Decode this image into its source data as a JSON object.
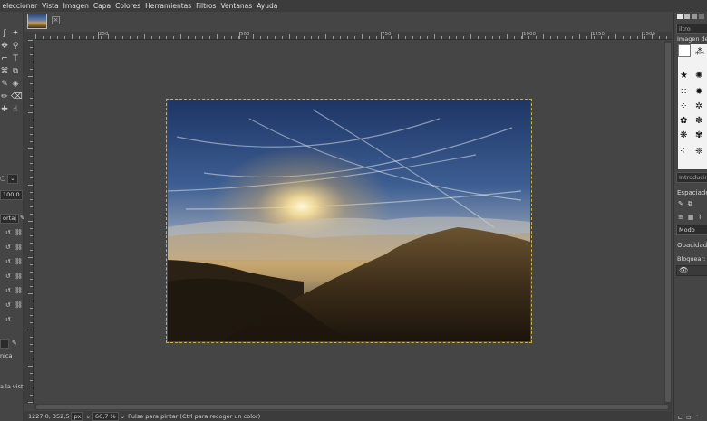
{
  "menubar": {
    "items": [
      "eleccionar",
      "Vista",
      "Imagen",
      "Capa",
      "Colores",
      "Herramientas",
      "Filtros",
      "Ventanas",
      "Ayuda"
    ]
  },
  "image_tab": {
    "close_glyph": "×"
  },
  "rulers": {
    "horizontal_labels": [
      "250",
      "500",
      "750",
      "1000",
      "1250",
      "1500"
    ]
  },
  "tool_options": {
    "size_value": "100,0",
    "spacing_label": "ortaj",
    "mode_label": "nica",
    "lock_label": "a la vista"
  },
  "statusbar": {
    "coords": "1227,0, 352,5",
    "unit": "px",
    "zoom": "66,7 %",
    "message": "Pulse para pintar (Ctrl para recoger un color)"
  },
  "dock": {
    "filter_placeholder": "iltro",
    "brush_name": "Imagen de",
    "tags_placeholder": "Introducir e",
    "spacing_label": "Espaciado",
    "mode_label": "Modo",
    "opacity_label": "Opacidad",
    "lock_label": "Bloquear:"
  },
  "colors": {
    "selection_outline": "#c8b24a",
    "panel_bg": "#454545",
    "menubar_bg": "#3c3c3c"
  }
}
